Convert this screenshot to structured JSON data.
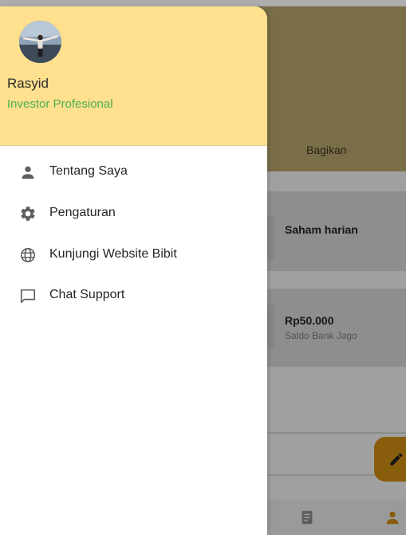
{
  "drawer": {
    "user": {
      "name": "Rasyid",
      "role": "Investor Profesional"
    },
    "menu": [
      {
        "label": "Tentang Saya",
        "icon": "person-icon"
      },
      {
        "label": "Pengaturan",
        "icon": "gear-icon"
      },
      {
        "label": "Kunjungi Website Bibit",
        "icon": "globe-icon"
      },
      {
        "label": "Chat Support",
        "icon": "chat-icon"
      }
    ]
  },
  "background": {
    "header_action": "Bagikan",
    "cards": [
      {
        "title": "Saham harian"
      },
      {
        "title": "Rp50.000",
        "subtitle": "Saldo Bank Jago"
      }
    ]
  },
  "colors": {
    "drawer_header": "#fee08e",
    "role_text": "#4caf50",
    "fab": "#f5a623"
  }
}
